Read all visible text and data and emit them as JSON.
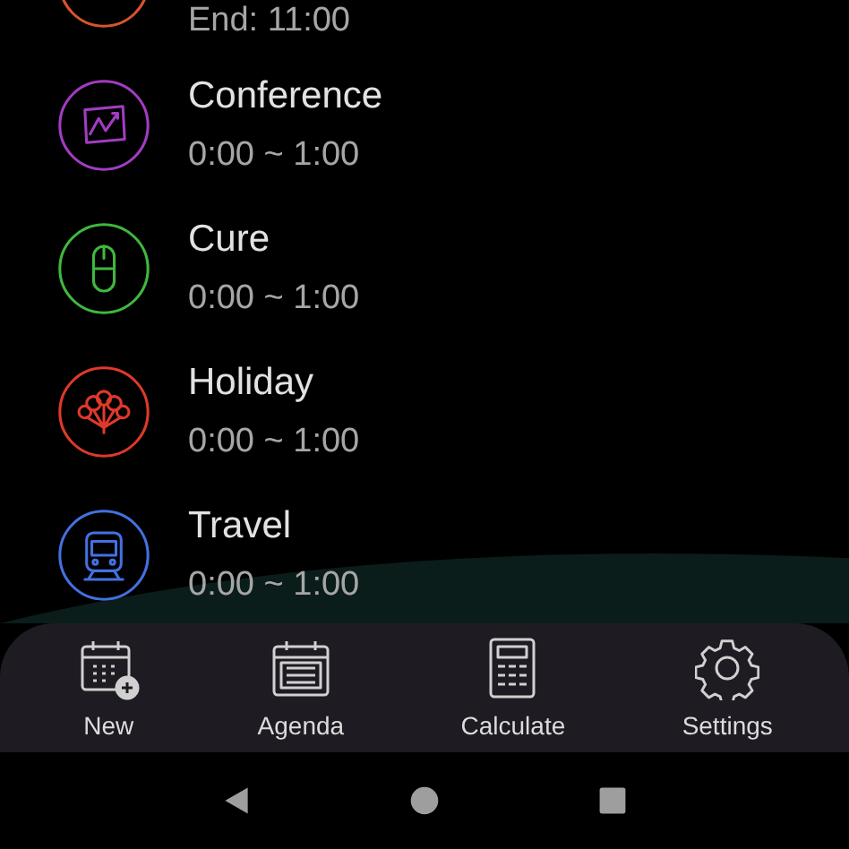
{
  "events": [
    {
      "time": "End: 11:00",
      "color": "#d8532c"
    },
    {
      "title": "Conference",
      "time": "0:00 ~ 1:00",
      "color": "#a23cc2"
    },
    {
      "title": "Cure",
      "time": "0:00 ~ 1:00",
      "color": "#3fb83f"
    },
    {
      "title": "Holiday",
      "time": "0:00 ~ 1:00",
      "color": "#e0392a"
    },
    {
      "title": "Travel",
      "time": "0:00 ~ 1:00",
      "color": "#4470e0"
    }
  ],
  "bottom_nav": [
    {
      "label": "New"
    },
    {
      "label": "Agenda"
    },
    {
      "label": "Calculate"
    },
    {
      "label": "Settings"
    }
  ]
}
